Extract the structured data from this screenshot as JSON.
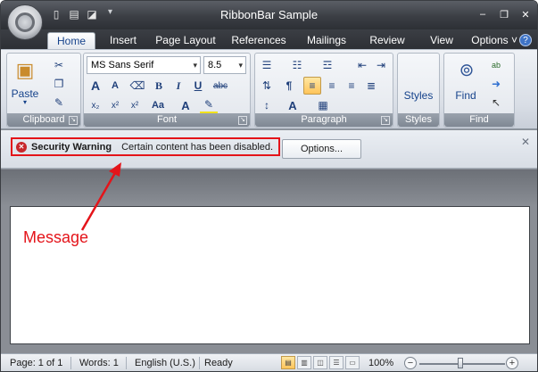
{
  "window": {
    "title": "RibbonBar Sample",
    "controls": {
      "minimize": "–",
      "restore": "❐",
      "close": "✕"
    },
    "qat_more": "▾"
  },
  "tabs": {
    "items": [
      "Home",
      "Insert",
      "Page Layout",
      "References",
      "Mailings",
      "Review",
      "View"
    ],
    "active": "Home",
    "options_label": "Options",
    "options_arrow": "˅",
    "help": "?"
  },
  "ribbon": {
    "clipboard": {
      "label": "Clipboard",
      "paste": "Paste",
      "paste_arrow": "▾"
    },
    "font": {
      "label": "Font",
      "font_name": "MS Sans Serif",
      "font_size": "8.5",
      "grow": "A",
      "shrink": "A",
      "bold": "B",
      "italic": "I",
      "underline": "U",
      "strike": "abc",
      "subscript": "x₂",
      "superscript": "x²",
      "change_case": "Aa",
      "font_color": "A"
    },
    "paragraph": {
      "label": "Paragraph",
      "pilcrow": "¶",
      "shading": "A"
    },
    "styles": {
      "label": "Styles",
      "button": "Styles"
    },
    "find": {
      "label": "Find",
      "button": "Find",
      "replace_icon": "ab"
    }
  },
  "security_bar": {
    "title": "Security Warning",
    "message": "Certain content has been disabled.",
    "options_button": "Options...",
    "close": "✕"
  },
  "annotation": {
    "label": "Message",
    "color": "#e4141a"
  },
  "status_bar": {
    "page": "Page: 1 of 1",
    "words": "Words: 1",
    "language": "English (U.S.)",
    "state": "Ready",
    "zoom": "100%",
    "zoom_minus": "−",
    "zoom_plus": "+"
  }
}
